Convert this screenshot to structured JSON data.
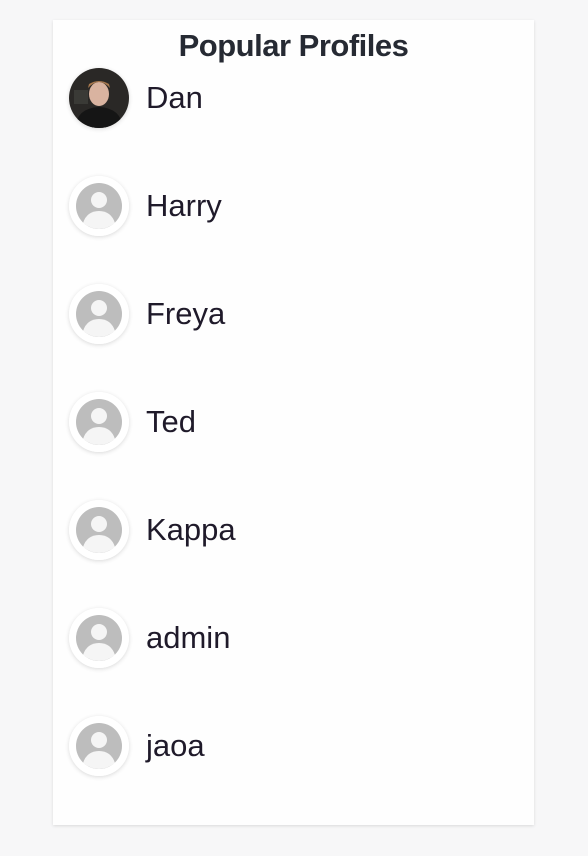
{
  "title": "Popular Profiles",
  "profiles": [
    {
      "name": "Dan",
      "avatar": "photo"
    },
    {
      "name": "Harry",
      "avatar": "default-user-icon"
    },
    {
      "name": "Freya",
      "avatar": "default-user-icon"
    },
    {
      "name": "Ted",
      "avatar": "default-user-icon"
    },
    {
      "name": "Kappa",
      "avatar": "default-user-icon"
    },
    {
      "name": "admin",
      "avatar": "default-user-icon"
    },
    {
      "name": "jaoa",
      "avatar": "default-user-icon"
    }
  ]
}
